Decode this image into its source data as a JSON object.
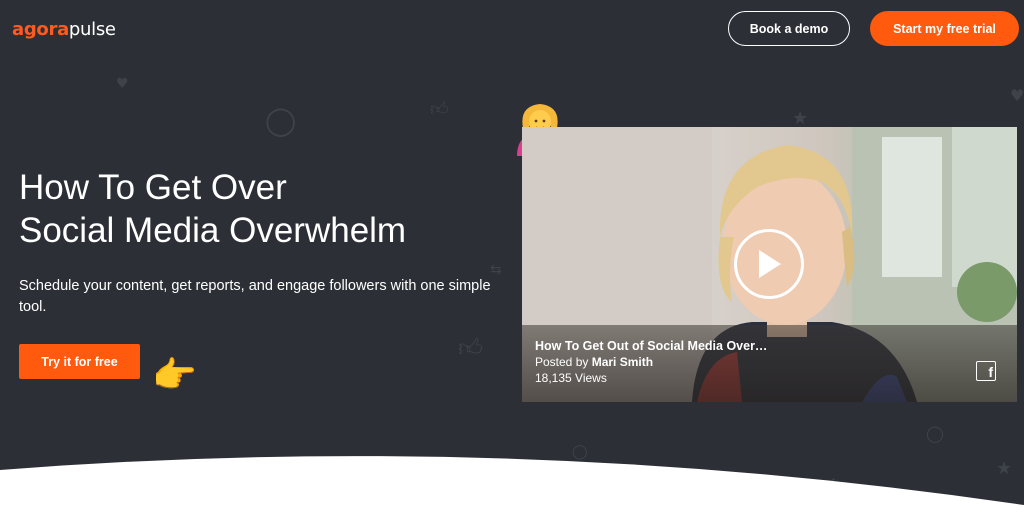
{
  "header": {
    "logo_part1": "agora",
    "logo_part2": "pulse",
    "book_demo_label": "Book a demo",
    "free_trial_label": "Start my free trial"
  },
  "hero": {
    "headline_line1": "How To Get Over",
    "headline_line2": "Social Media Overwhelm",
    "subtitle": "Schedule your content, get reports, and engage followers with one simple tool.",
    "cta_label": "Try it for free"
  },
  "video": {
    "title": "How To Get Out of Social Media Over…",
    "posted_by_prefix": "Posted by",
    "author": "Mari Smith",
    "views": "18,135 Views"
  },
  "icons": {
    "pointing_hand": "backhand-index-pointing-right-icon",
    "woman_tipping_hand": "woman-tipping-hand-icon",
    "play": "play-icon",
    "facebook": "facebook-icon"
  },
  "colors": {
    "background": "#2c3036",
    "accent": "#ff5a0d",
    "text": "#ffffff"
  }
}
